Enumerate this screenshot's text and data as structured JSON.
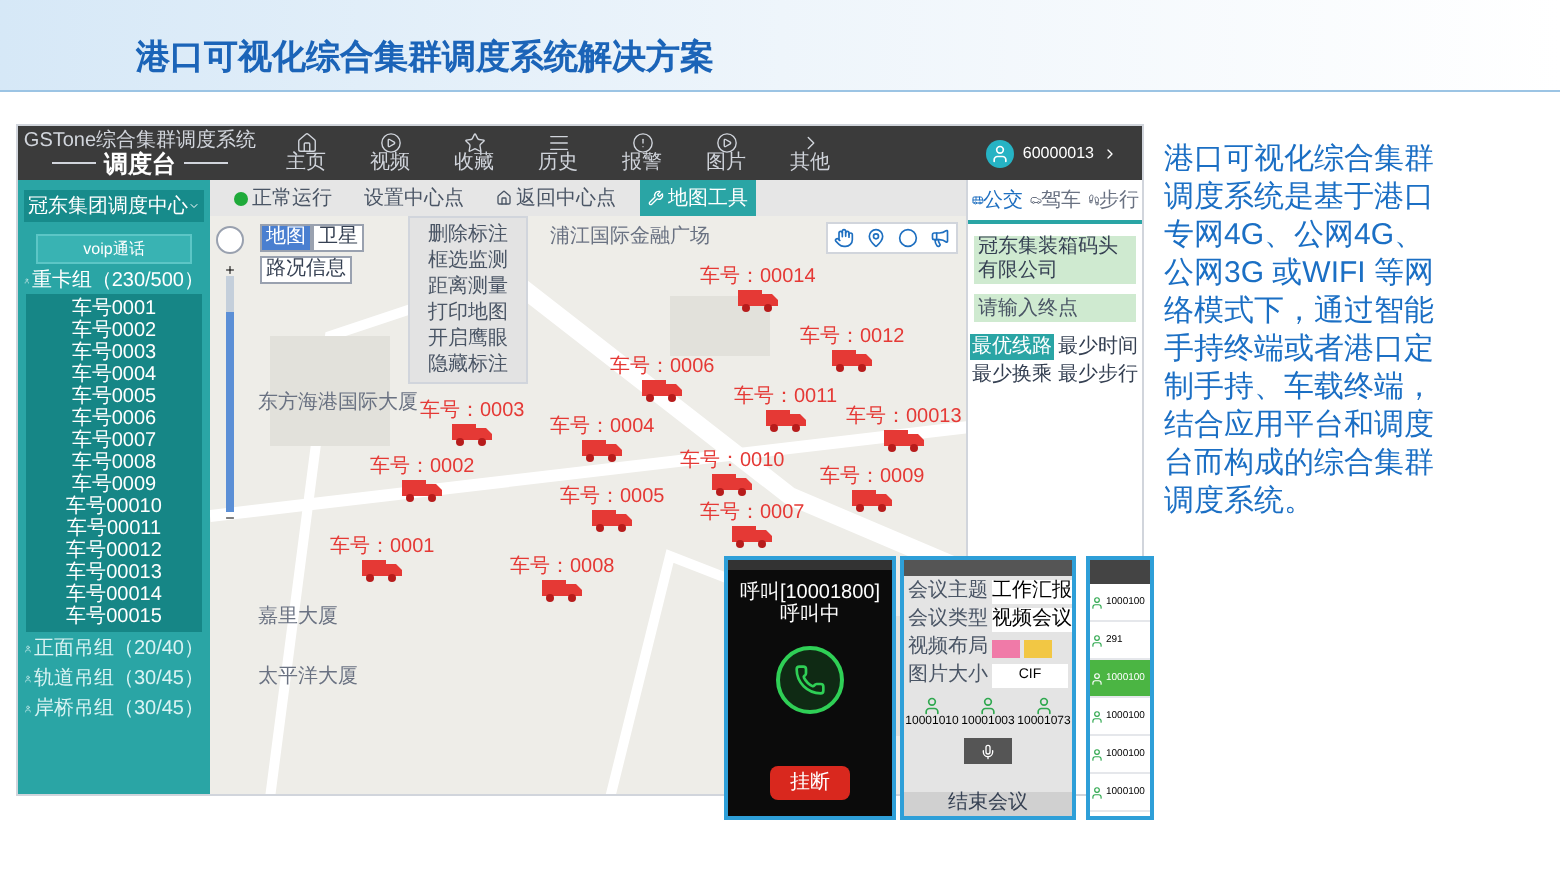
{
  "title": "港口可视化综合集群调度系统解决方案",
  "app": {
    "brand_small": "GSTone综合集群调度系统",
    "brand": "调度台",
    "nav": [
      {
        "label": "主页",
        "kind": "home"
      },
      {
        "label": "视频",
        "kind": "play"
      },
      {
        "label": "收藏",
        "kind": "star"
      },
      {
        "label": "历史",
        "kind": "list"
      },
      {
        "label": "报警",
        "kind": "alert"
      },
      {
        "label": "图片",
        "kind": "play"
      },
      {
        "label": "其他",
        "kind": "more"
      }
    ],
    "user": "60000013",
    "sidebar": {
      "center": "冠东集团调度中心",
      "voip": "voip通话",
      "groups": [
        {
          "label": "重卡组（230/500）",
          "expanded": true,
          "items": [
            "车号0001",
            "车号0002",
            "车号0003",
            "车号0004",
            "车号0005",
            "车号0006",
            "车号0007",
            "车号0008",
            "车号0009",
            "车号00010",
            "车号00011",
            "车号00012",
            "车号00013",
            "车号00014",
            "车号00015"
          ]
        },
        {
          "label": "正面吊组（20/40）",
          "expanded": false
        },
        {
          "label": "轨道吊组（30/45）",
          "expanded": false
        },
        {
          "label": "岸桥吊组（30/45）",
          "expanded": false
        }
      ]
    },
    "map_zoom": {
      "level": 0.85
    },
    "map_toolbar": [
      {
        "label": "正常运行",
        "kind": "status",
        "selected": false
      },
      {
        "label": "设置中心点",
        "kind": "plain",
        "selected": false
      },
      {
        "label": "返回中心点",
        "kind": "home",
        "selected": false
      },
      {
        "label": "地图工具",
        "kind": "tools",
        "selected": true
      }
    ],
    "tool_menu": [
      "删除标注",
      "框选监测",
      "距离测量",
      "打印地图",
      "开启鹰眼",
      "隐藏标注"
    ],
    "map_types": [
      {
        "label": "地图",
        "selected": true
      },
      {
        "label": "卫星",
        "selected": false
      }
    ],
    "traffic": "路况信息",
    "places": [
      "东方海港国际大厦",
      "浦江国际金融广场",
      "嘉里大厦",
      "太平洋大厦"
    ],
    "trucks": [
      "车号：0001",
      "车号：0002",
      "车号：0003",
      "车号：0004",
      "车号：0005",
      "车号：0006",
      "车号：0007",
      "车号：0008",
      "车号：0009",
      "车号：0010",
      "车号：0011",
      "车号：0012",
      "车号：00013",
      "车号：00014"
    ],
    "route": {
      "modes": [
        {
          "label": "公交",
          "kind": "bus",
          "selected": true
        },
        {
          "label": "驾车",
          "kind": "car",
          "selected": false
        },
        {
          "label": "步行",
          "kind": "walk",
          "selected": false
        }
      ],
      "start": "冠东集装箱码头有限公司",
      "end_placeholder": "请输入终点",
      "tabs": [
        {
          "label": "最优线路",
          "selected": true
        },
        {
          "label": "最少时间",
          "selected": false
        },
        {
          "label": "最少换乘",
          "selected": false
        },
        {
          "label": "最少步行",
          "selected": false
        }
      ]
    }
  },
  "phones": {
    "call": {
      "title": "呼叫[10001800]",
      "status": "呼叫中",
      "hangup": "挂断"
    },
    "meeting": {
      "fields": [
        {
          "label": "会议主题",
          "value": "工作汇报",
          "kind": "text"
        },
        {
          "label": "会议类型",
          "value": "视频会议",
          "kind": "text"
        },
        {
          "label": "视频布局",
          "kind": "layout"
        },
        {
          "label": "图片大小",
          "value": "CIF",
          "kind": "select"
        }
      ],
      "participants": [
        "10001010",
        "10001003",
        "10001073"
      ],
      "end": "结束会议"
    },
    "contacts": [
      {
        "number": "1000100",
        "selected": false
      },
      {
        "number": "291",
        "selected": false
      },
      {
        "number": "1000100",
        "selected": true
      },
      {
        "number": "1000100",
        "selected": false
      },
      {
        "number": "1000100",
        "selected": false
      },
      {
        "number": "1000100",
        "selected": false
      }
    ]
  },
  "description": "港口可视化综合集群调度系统是基于港口专网4G、公网4G、公网3G 或WIFI 等网络模式下，通过智能手持终端或者港口定制手持、车载终端，结合应用平台和调度台而构成的综合集群调度系统。"
}
